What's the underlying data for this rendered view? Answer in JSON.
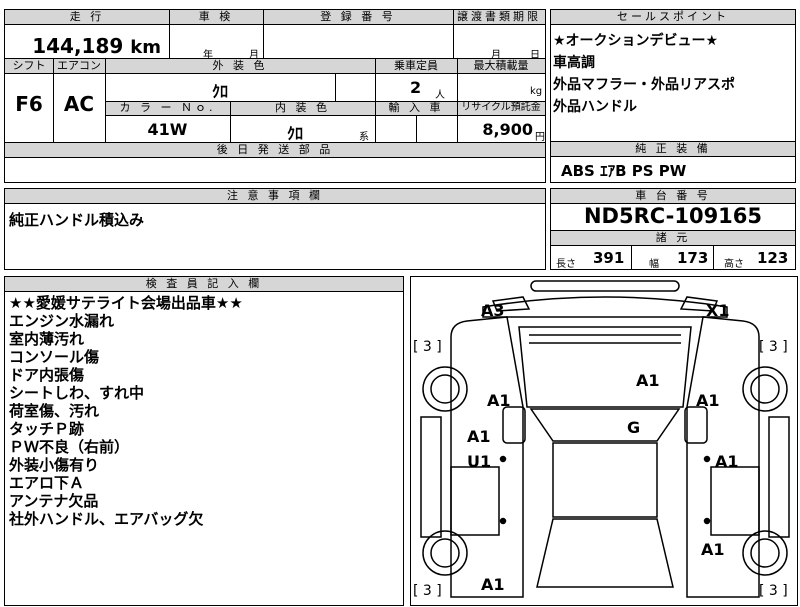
{
  "header": {
    "mileage_label": "走 行",
    "inspection_label": "車 検",
    "reg_label": "登 録 番 号",
    "transfer_label": "譲渡書類期限",
    "sales_label": "セールスポイント"
  },
  "mileage": {
    "value": "144,189",
    "unit": "km"
  },
  "inspection": {
    "year": "年",
    "month": "月"
  },
  "transfer": {
    "month": "月",
    "day": "日"
  },
  "specs": {
    "shift_label": "シフト",
    "ac_label": "エアコン",
    "exterior_label": "外 装 色",
    "capacity_label": "乗車定員",
    "payload_label": "最大積載量",
    "shift_value": "F6",
    "ac_value": "AC",
    "exterior_value": "ｸﾛ",
    "capacity_value": "2",
    "capacity_unit": "人",
    "payload_unit": "kg",
    "color_no_label": "カ ラ ー Ｎｏ.",
    "interior_label": "内 装 色",
    "import_label": "輸 入 車",
    "recycle_label": "リサイクル預託金",
    "color_no_value": "41W",
    "interior_value": "ｸﾛ",
    "interior_suffix": "系",
    "recycle_value": "8,900",
    "recycle_unit": "円",
    "parts_label": "後 日 発 送 部 品"
  },
  "sales_points": [
    "★オークションデビュー★",
    "車高調",
    "外品マフラー・外品リアスポ",
    "外品ハンドル"
  ],
  "equipment": {
    "label": "純 正 装 備",
    "value": "ABS ｴｱB PS PW"
  },
  "notes": {
    "label": "注 意 事 項 欄",
    "value": "純正ハンドル積込み"
  },
  "chassis": {
    "label": "車 台 番 号",
    "value": "ND5RC-109165"
  },
  "dimensions": {
    "label": "諸 元",
    "length_label": "長さ",
    "length_value": "391",
    "width_label": "幅",
    "width_value": "173",
    "height_label": "高さ",
    "height_value": "123"
  },
  "inspector": {
    "label": "検 査 員 記 入 欄",
    "lines": [
      "★★愛媛サテライト会場出品車★★",
      "エンジン水漏れ",
      "室内薄汚れ",
      "コンソール傷",
      "ドア内張傷",
      "シートしわ、すれ中",
      "荷室傷、汚れ",
      "タッチＰ跡",
      "ＰＷ不良（右前）",
      "外装小傷有り",
      "エアロ下Ａ",
      "アンテナ欠品",
      "社外ハンドル、エアバッグ欠"
    ]
  },
  "diagram": {
    "marks": {
      "a3": "A3",
      "x1": "X1",
      "tire_fl": "[ 3 ]",
      "tire_fr": "[ 3 ]",
      "tire_rl": "[ 3 ]",
      "tire_rr": "[ 3 ]",
      "hood": "A1",
      "left_front": "A1",
      "right_front": "A1",
      "roof": "G",
      "left_door1": "A1",
      "left_door2": "U1",
      "right_door": "A1",
      "right_rear": "A1",
      "left_rear": "A1"
    }
  }
}
